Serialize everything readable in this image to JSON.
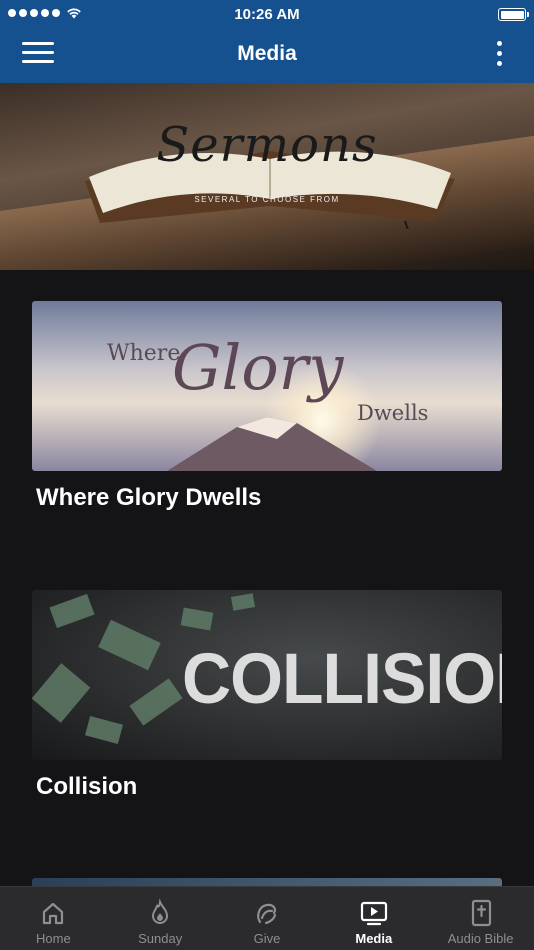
{
  "status_bar": {
    "time": "10:26 AM"
  },
  "nav": {
    "title": "Media"
  },
  "hero": {
    "title": "Sermons",
    "subtitle": "SEVERAL TO CHOOSE FROM"
  },
  "series": [
    {
      "title": "Where Glory Dwells",
      "art": {
        "line1": "Where",
        "line2": "Glory",
        "line3": "Dwells"
      }
    },
    {
      "title": "Collision",
      "art": {
        "word": "COLLISION"
      }
    }
  ],
  "tabs": [
    {
      "label": "Home",
      "icon": "home-icon",
      "active": false
    },
    {
      "label": "Sunday",
      "icon": "flame-icon",
      "active": false
    },
    {
      "label": "Give",
      "icon": "give-icon",
      "active": false
    },
    {
      "label": "Media",
      "icon": "media-icon",
      "active": true
    },
    {
      "label": "Audio Bible",
      "icon": "bible-icon",
      "active": false
    }
  ],
  "colors": {
    "brand": "#16518f",
    "background": "#141416",
    "tabbar": "#2b2b2d"
  }
}
